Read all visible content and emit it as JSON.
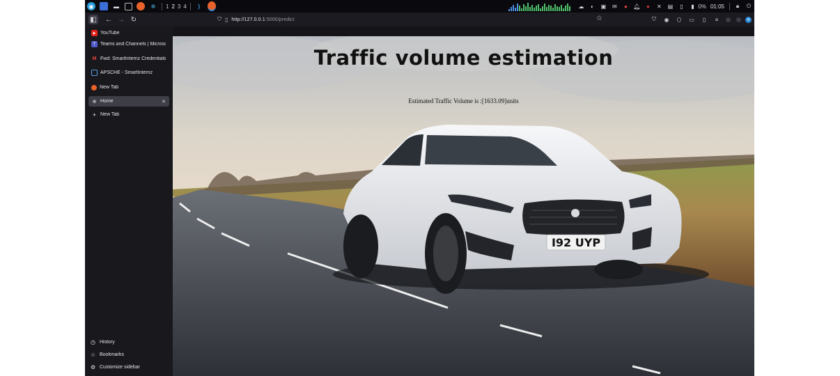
{
  "taskbar": {
    "workspaces": [
      "1",
      "2",
      "3",
      "4"
    ],
    "battery": "0%",
    "clock": "01:05"
  },
  "browser": {
    "url_host": "http://127.0.0.1",
    "url_rest": ":5000/predict"
  },
  "sidebar": {
    "tabs": [
      {
        "label": "YouTube",
        "icon": "youtube-icon"
      },
      {
        "label": "Teams and Channels | Microsoft",
        "icon": "teams-icon"
      },
      {
        "label": "Fwd: SmartInternz Credentials",
        "icon": "gmail-icon"
      },
      {
        "label": "APSCHE - SmartInternz",
        "icon": "page-icon"
      },
      {
        "label": "New Tab",
        "icon": "firefox-icon"
      },
      {
        "label": "Home",
        "icon": "globe-icon"
      },
      {
        "label": "New Tab",
        "icon": "plus-icon"
      }
    ],
    "footer": {
      "history": "History",
      "bookmarks": "Bookmarks",
      "customize": "Customize sidebar"
    }
  },
  "page": {
    "title": "Traffic volume estimation",
    "result": "Estimated Traffic Volume is :[1633.09]units",
    "license_plate": "I92 UYP"
  },
  "colors": {
    "accent": "#2a8bd8",
    "sidebar_bg": "#18181d",
    "toolbar_bg": "#1c1b22"
  }
}
